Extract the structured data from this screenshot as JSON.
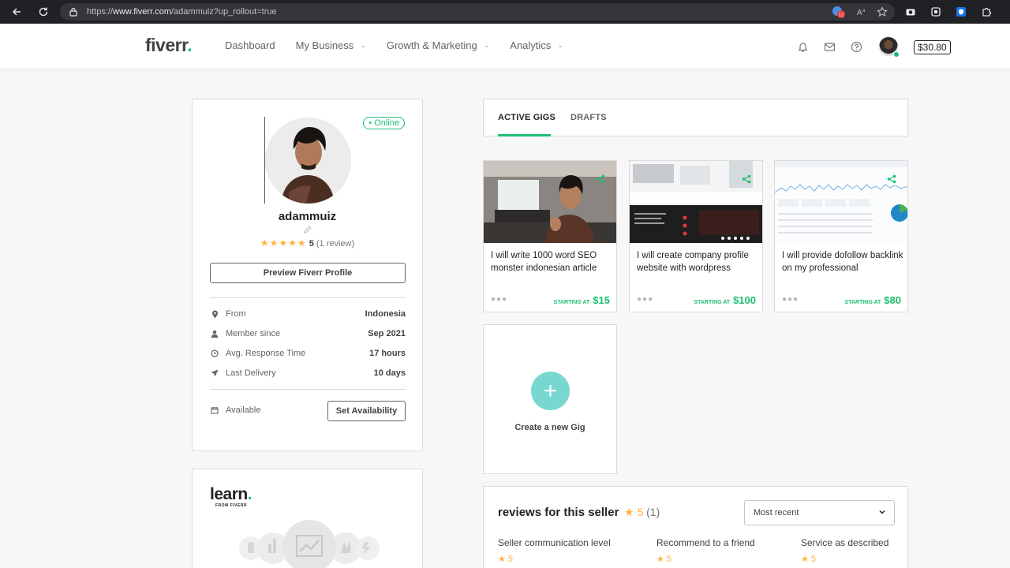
{
  "browser": {
    "url_prefix": "https://",
    "url_host": "www.fiverr.com",
    "url_path": "/adammuiz?up_rollout=true",
    "notif_count": "12"
  },
  "header": {
    "logo": "fiverr",
    "logo_dot": ".",
    "nav": [
      {
        "label": "Dashboard"
      },
      {
        "label": "My Business"
      },
      {
        "label": "Growth & Marketing"
      },
      {
        "label": "Analytics"
      }
    ],
    "balance": "$30.80"
  },
  "profile": {
    "online": "• Online",
    "username": "adammuiz",
    "rating_stars": "★★★★★",
    "rating_value": "5",
    "review_count": "(1 review)",
    "preview_button": "Preview Fiverr Profile",
    "stats": [
      {
        "label": "From",
        "value": "Indonesia",
        "icon": "location-icon"
      },
      {
        "label": "Member since",
        "value": "Sep 2021",
        "icon": "user-icon"
      },
      {
        "label": "Avg. Response Time",
        "value": "17 hours",
        "icon": "clock-icon"
      },
      {
        "label": "Last Delivery",
        "value": "10 days",
        "icon": "send-icon"
      }
    ],
    "availability_label": "Available",
    "availability_button": "Set Availability"
  },
  "learn": {
    "logo": "learn",
    "logo_dot": ".",
    "subtitle": "FROM FIVERR"
  },
  "tabs": {
    "active": "ACTIVE GIGS",
    "drafts": "DRAFTS"
  },
  "gigs": [
    {
      "title": "I will write 1000 word SEO monster indonesian article",
      "starting_at": "STARTING AT",
      "price": "$15"
    },
    {
      "title": "I will create company profile website with wordpress",
      "starting_at": "STARTING AT",
      "price": "$100"
    },
    {
      "title": "I will provide dofollow backlink on my professional",
      "starting_at": "STARTING AT",
      "price": "$80"
    }
  ],
  "create_gig": {
    "plus": "+",
    "label": "Create a new Gig"
  },
  "reviews": {
    "title": "reviews for this seller",
    "score": "★ 5",
    "count": "(1)",
    "sort_value": "Most recent",
    "criteria": [
      {
        "label": "Seller communication level",
        "score": "★ 5"
      },
      {
        "label": "Recommend to a friend",
        "score": "★ 5"
      },
      {
        "label": "Service as described",
        "score": "★ 5"
      }
    ]
  },
  "colors": {
    "brand_green": "#1dbf73",
    "star": "#ffb33e",
    "create_circle": "#78d8d0"
  }
}
